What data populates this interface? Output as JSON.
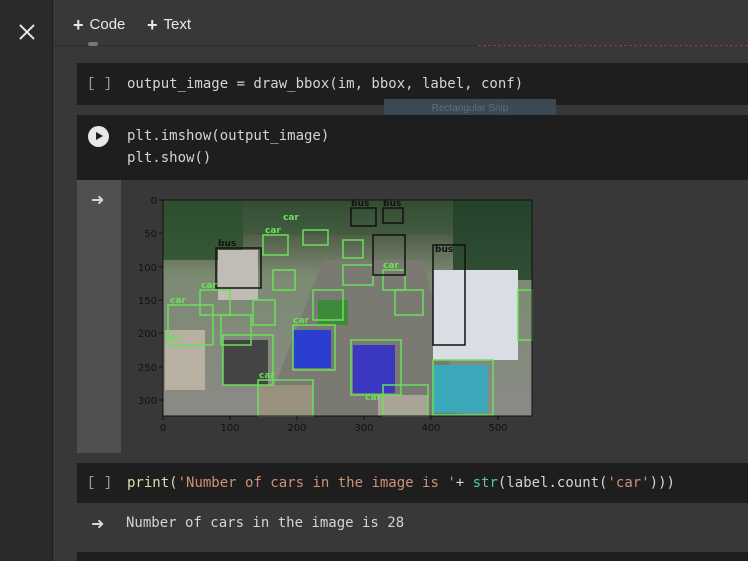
{
  "toolbar": {
    "code_label": "Code",
    "text_label": "Text"
  },
  "cells": [
    {
      "bracket": "[ ]",
      "code": "output_image = draw_bbox(im, bbox, label, conf)"
    },
    {
      "code_lines": [
        "plt.imshow(output_image)",
        "plt.show()"
      ]
    },
    {
      "bracket": "[ ]",
      "code_parts": {
        "fn": "print",
        "open": "(",
        "str1": "'Number of cars in the image is '",
        "plus": "+ ",
        "bi": "str",
        "rest_open": "(label.count(",
        "str2": "'car'",
        "close": ")))"
      }
    }
  ],
  "tooltip": "Rectangular Snip",
  "plot": {
    "x_ticks": [
      "0",
      "100",
      "200",
      "300",
      "400",
      "500"
    ],
    "y_ticks": [
      "0",
      "50",
      "100",
      "150",
      "200",
      "250",
      "300"
    ],
    "box_labels": [
      "car",
      "bus"
    ]
  },
  "output_text": "Number of cars in the image is 28"
}
